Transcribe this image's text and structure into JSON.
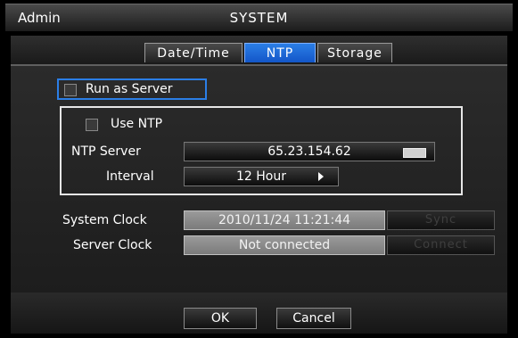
{
  "header": {
    "user": "Admin",
    "title": "SYSTEM"
  },
  "tabs": [
    {
      "label": "Date/Time"
    },
    {
      "label": "NTP"
    },
    {
      "label": "Storage"
    }
  ],
  "ntp": {
    "run_as_server_label": "Run as Server",
    "run_as_server_checked": false,
    "use_ntp_label": "Use NTP",
    "use_ntp_checked": false,
    "server_label": "NTP Server",
    "server_value": "65.23.154.62",
    "interval_label": "Interval",
    "interval_value": "12 Hour"
  },
  "clock": {
    "system_label": "System Clock",
    "system_value": "2010/11/24  11:21:44",
    "sync_label": "Sync",
    "server_label": "Server Clock",
    "server_value": "Not connected",
    "connect_label": "Connect"
  },
  "footer": {
    "ok": "OK",
    "cancel": "Cancel"
  },
  "icons": {
    "keyboard": "keyboard-icon",
    "dropdown": "arrow-right-icon"
  },
  "colors": {
    "accent": "#1e6fe0",
    "active_tab": "#1356c8",
    "group_border": "#e6e6e6"
  }
}
